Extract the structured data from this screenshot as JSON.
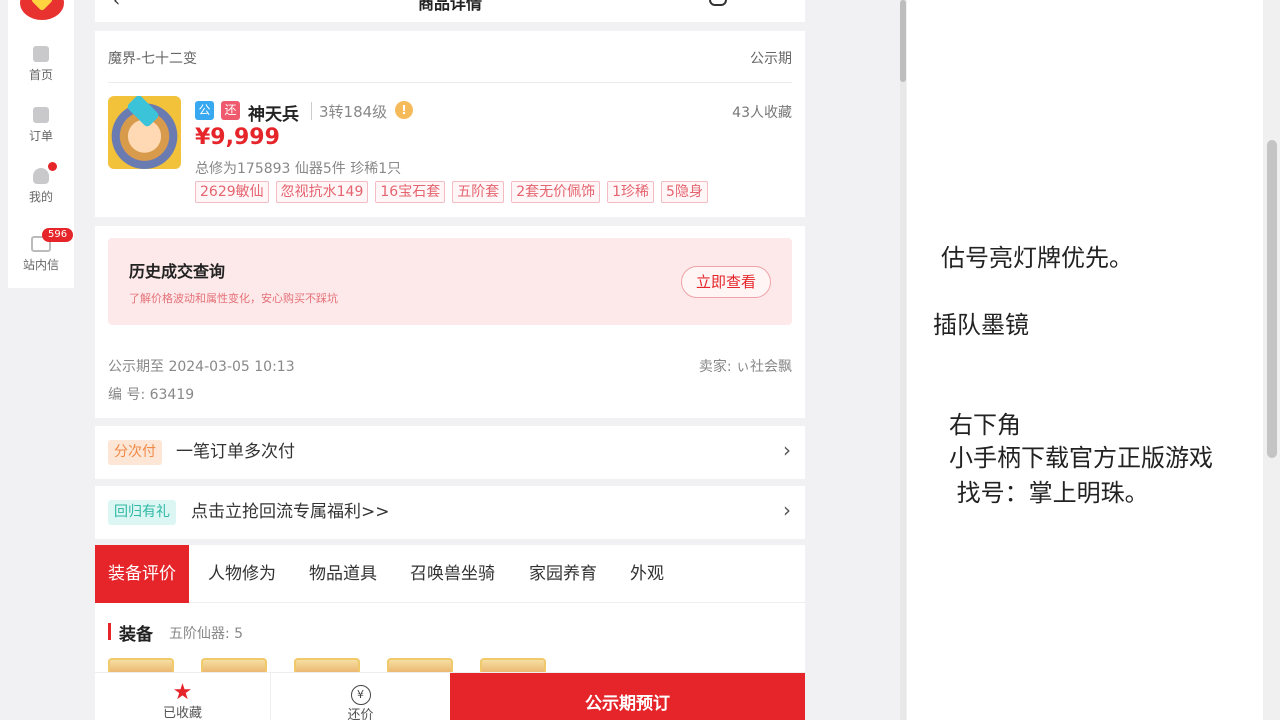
{
  "sidebar": {
    "items": [
      {
        "label": "首页",
        "icon": "home-icon"
      },
      {
        "label": "订单",
        "icon": "order-icon"
      },
      {
        "label": "我的",
        "icon": "user-icon"
      },
      {
        "label": "站内信",
        "icon": "mail-icon",
        "badge": "596"
      }
    ]
  },
  "header": {
    "back": "‹",
    "title": "商品详情"
  },
  "item": {
    "server": "魔界-七十二变",
    "status": "公示期",
    "tag_public": "公",
    "tag_bargain": "还",
    "role": "神天兵",
    "level": "3转184级",
    "warn": "!",
    "favorites": "43人收藏",
    "price": "¥9,999",
    "summary": "总修为175893  仙器5件  珍稀1只",
    "chips": [
      "2629敏仙",
      "忽视抗水149",
      "16宝石套",
      "五阶套",
      "2套无价佩饰",
      "1珍稀",
      "5隐身"
    ]
  },
  "history": {
    "title": "历史成交查询",
    "subtitle": "了解价格波动和属性变化，安心购买不踩坑",
    "button": "立即查看"
  },
  "meta": {
    "public_until": "公示期至 2024-03-05 10:13",
    "seller": "卖家: ぃ社会飘",
    "code": "编 号: 63419"
  },
  "rows": {
    "installment_label": "分次付",
    "installment_text": "一笔订单多次付",
    "return_label": "回归有礼",
    "return_text": "点击立抢回流专属福利>>",
    "arrow": "›"
  },
  "tabs": [
    "装备评价",
    "人物修为",
    "物品道具",
    "召唤兽坐骑",
    "家园养育",
    "外观"
  ],
  "equip": {
    "title": "装备",
    "subtitle": "五阶仙器: 5"
  },
  "bottom": {
    "fav_label": "已收藏",
    "bargain_label": "还价",
    "yen": "¥",
    "reserve_label": "公示期预订"
  },
  "notes": {
    "line1": "估号亮灯牌优先。",
    "line2": "插队墨镜",
    "line3": "右下角",
    "line4": "小手柄下载官方正版游戏",
    "line5": " 找号：掌上明珠。"
  },
  "colors": {
    "accent": "#e5252a",
    "history_bg": "#fde9ea",
    "installment_tag": "#f08a45",
    "return_tag": "#30b8a5"
  }
}
